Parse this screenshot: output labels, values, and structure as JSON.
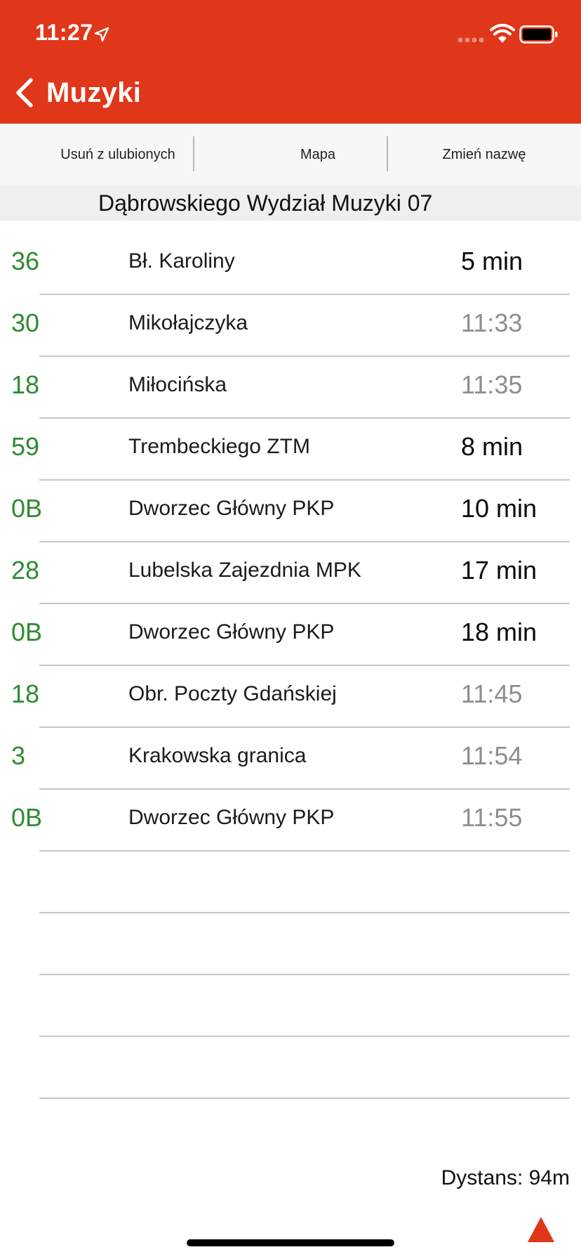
{
  "status_bar": {
    "time": "11:27"
  },
  "nav": {
    "back_label": "Muzyki"
  },
  "toolbar": {
    "remove_favorite": "Usuń z ulubionych",
    "map": "Mapa",
    "rename": "Zmień nazwę"
  },
  "stop": {
    "name": "Dąbrowskiego Wydział Muzyki 07"
  },
  "departures": [
    {
      "line": "36",
      "destination": "Bł. Karoliny",
      "eta": "5 min",
      "eta_type": "relative"
    },
    {
      "line": "30",
      "destination": "Mikołajczyka",
      "eta": "11:33",
      "eta_type": "clock"
    },
    {
      "line": "18",
      "destination": "Miłocińska",
      "eta": "11:35",
      "eta_type": "clock"
    },
    {
      "line": "59",
      "destination": "Trembeckiego ZTM",
      "eta": "8 min",
      "eta_type": "relative"
    },
    {
      "line": "0B",
      "destination": "Dworzec Główny PKP",
      "eta": "10 min",
      "eta_type": "relative"
    },
    {
      "line": "28",
      "destination": "Lubelska Zajezdnia MPK",
      "eta": "17 min",
      "eta_type": "relative"
    },
    {
      "line": "0B",
      "destination": "Dworzec Główny PKP",
      "eta": "18 min",
      "eta_type": "relative"
    },
    {
      "line": "18",
      "destination": "Obr. Poczty Gdańskiej",
      "eta": "11:45",
      "eta_type": "clock"
    },
    {
      "line": "3",
      "destination": "Krakowska granica",
      "eta": "11:54",
      "eta_type": "clock"
    },
    {
      "line": "0B",
      "destination": "Dworzec Główny PKP",
      "eta": "11:55",
      "eta_type": "clock"
    }
  ],
  "empty_rows": 4,
  "footer": {
    "distance": "Dystans: 94m"
  },
  "colors": {
    "header": "#E0361A",
    "line_number": "#2E8B33",
    "eta_relative": "#0A0A0A",
    "eta_clock": "#8E8E8E",
    "nav_arrow": "#E0361A"
  },
  "icons": [
    "location-arrow-icon",
    "signal-icon",
    "wifi-icon",
    "battery-icon",
    "back-chevron-icon",
    "navigation-triangle-icon"
  ]
}
